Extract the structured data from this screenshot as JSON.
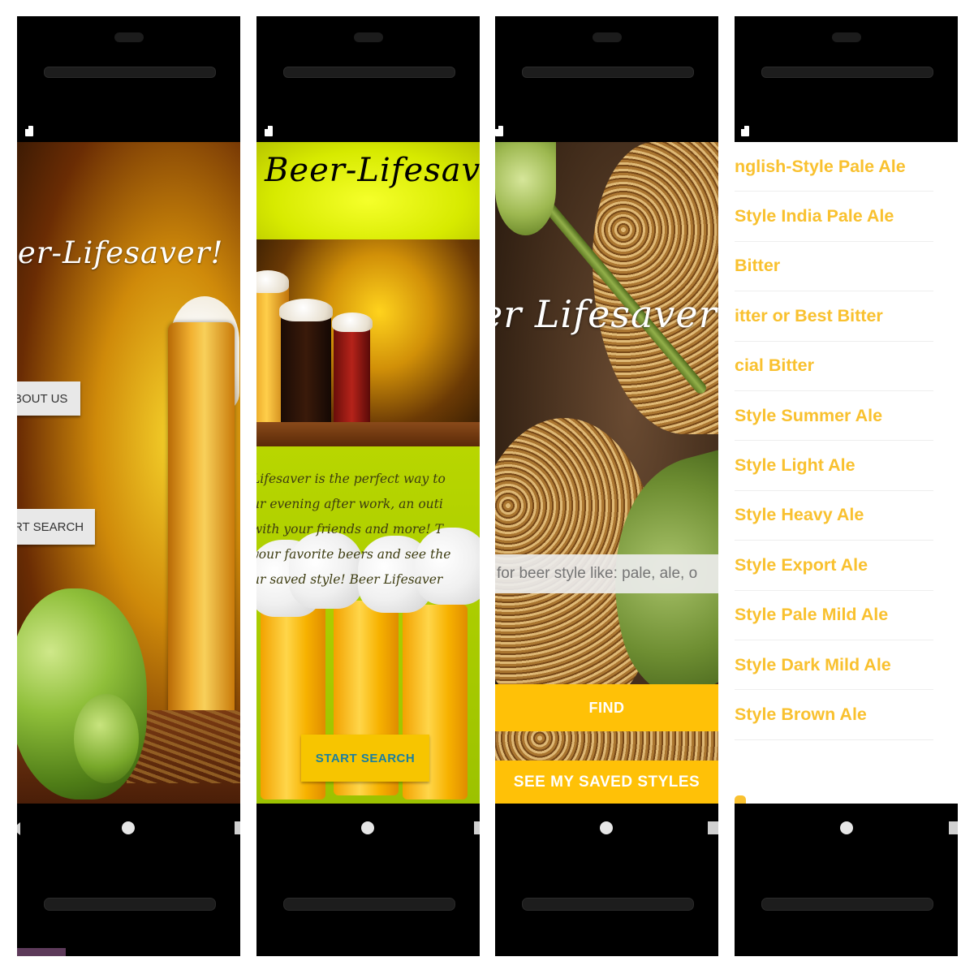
{
  "screens": {
    "s1": {
      "title": "eer-Lifesaver!",
      "about_label": "BOUT US",
      "start_label": "RT SEARCH"
    },
    "s2": {
      "title": "Beer-Lifesav",
      "lines": [
        "Lifesaver is the perfect way to",
        "ur evening after work, an outi",
        "with your friends and more! T",
        "your favorite beers and see the",
        "ur saved style! Beer Lifesaver"
      ],
      "start_label": "START SEARCH"
    },
    "s3": {
      "title": "er Lifesaver",
      "search_placeholder": "for beer style like: pale, ale, o",
      "find_label": "FIND",
      "saved_label": "SEE MY SAVED STYLES"
    },
    "s4": {
      "styles": [
        "nglish-Style Pale Ale",
        "Style India Pale Ale",
        "Bitter",
        "itter or Best Bitter",
        "cial Bitter",
        "Style Summer Ale",
        "Style Light Ale",
        "Style Heavy Ale",
        "Style Export Ale",
        "Style Pale Mild Ale",
        "Style Dark Mild Ale",
        "Style Brown Ale"
      ]
    }
  },
  "colors": {
    "accent_yellow": "#ffc107",
    "list_text": "#f9c12f",
    "header_yellow": "#d7ea00",
    "button_text_blue": "#1a7fa0"
  },
  "icons": [
    "sd-card-icon",
    "back-icon",
    "home-icon",
    "recents-icon"
  ]
}
